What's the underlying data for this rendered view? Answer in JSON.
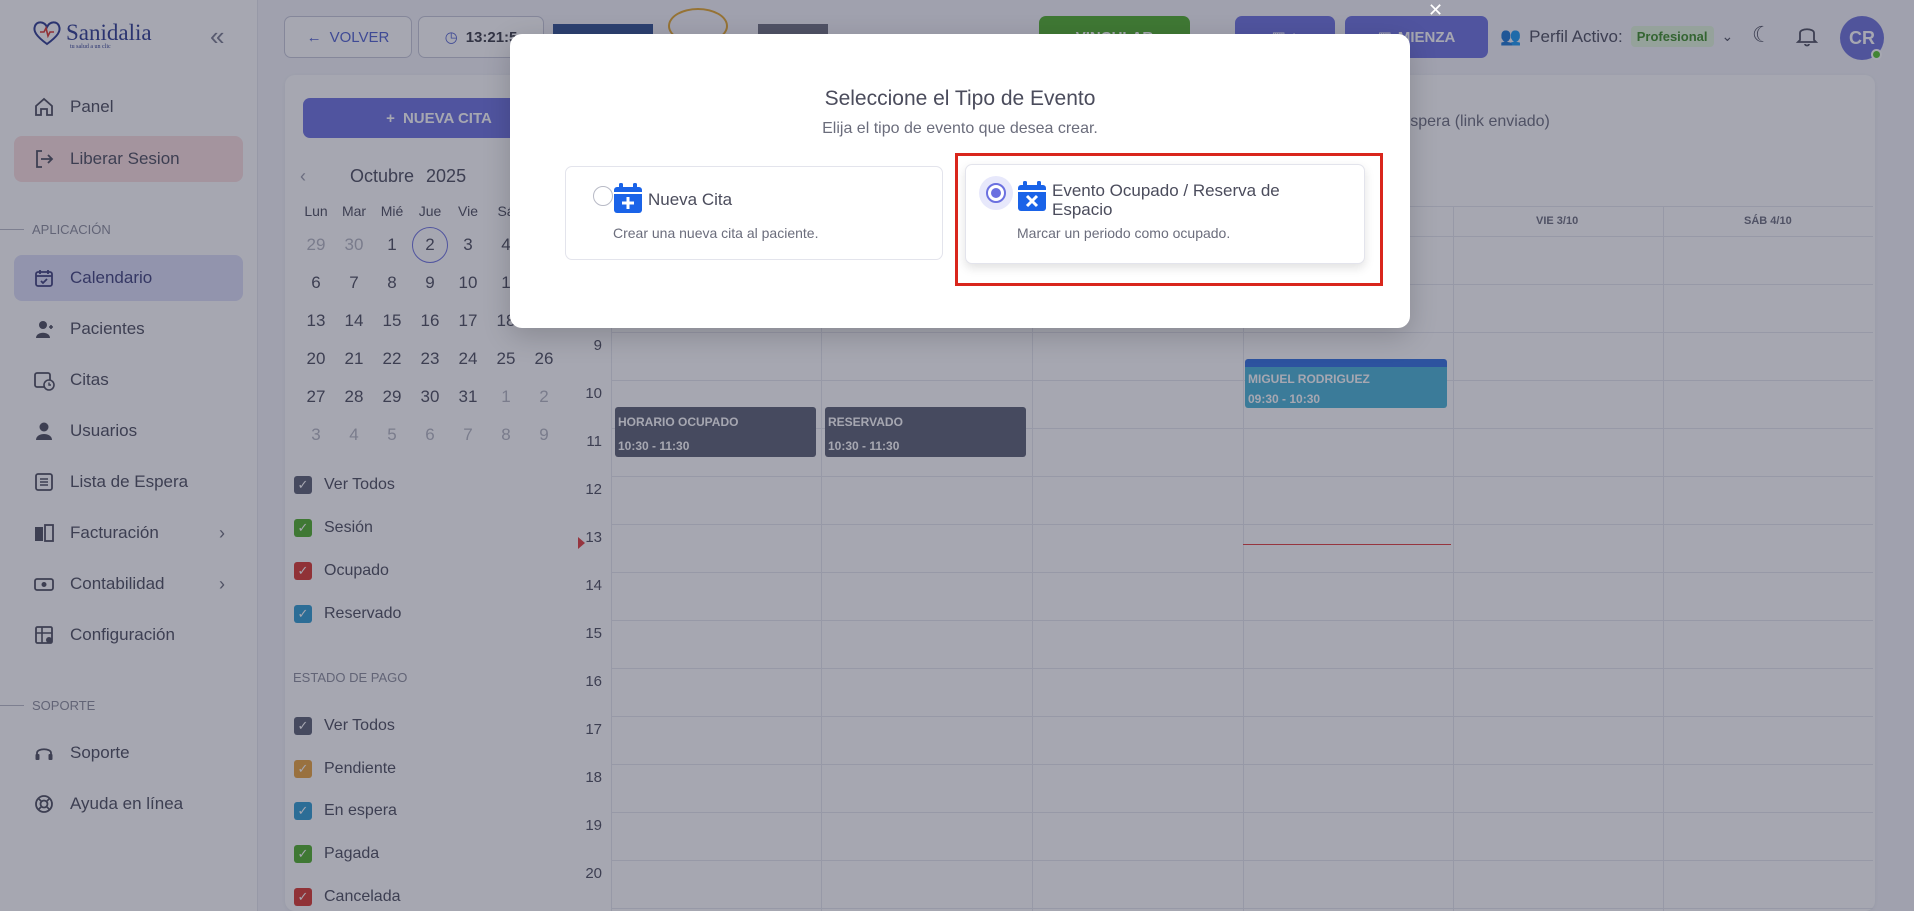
{
  "sidebar": {
    "logo": "Sanidalia",
    "logo_tagline": "tu salud a un clic",
    "items": [
      {
        "label": "Panel"
      },
      {
        "label": "Liberar Sesion"
      },
      {
        "label": "Calendario"
      },
      {
        "label": "Pacientes"
      },
      {
        "label": "Citas"
      },
      {
        "label": "Usuarios"
      },
      {
        "label": "Lista de Espera"
      },
      {
        "label": "Facturación"
      },
      {
        "label": "Contabilidad"
      },
      {
        "label": "Configuración"
      },
      {
        "label": "Soporte"
      },
      {
        "label": "Ayuda en línea"
      }
    ],
    "section_app": "APLICACIÓN",
    "section_support": "SOPORTE"
  },
  "topbar": {
    "back": "VOLVER",
    "clock": "13:21:5",
    "link_label": "VINCULAR",
    "start_label": "MIENZA",
    "profile_label": "Perfil Activo:",
    "profile_value": "Profesional",
    "avatar": "CR"
  },
  "calendar": {
    "new_cita": "NUEVA CITA",
    "month": "Octubre",
    "year": "2025",
    "weekdays": [
      "Lun",
      "Mar",
      "Mié",
      "Jue",
      "Vie",
      "Sá"
    ],
    "weeks": [
      [
        "29",
        "30",
        "1",
        "2",
        "3",
        "4",
        ""
      ],
      [
        "6",
        "7",
        "8",
        "9",
        "10",
        "1",
        ""
      ],
      [
        "13",
        "14",
        "15",
        "16",
        "17",
        "18",
        ""
      ],
      [
        "20",
        "21",
        "22",
        "23",
        "24",
        "25",
        "26"
      ],
      [
        "27",
        "28",
        "29",
        "30",
        "31",
        "1",
        "2"
      ],
      [
        "3",
        "4",
        "5",
        "6",
        "7",
        "8",
        "9"
      ]
    ],
    "filters_type": [
      {
        "label": "Ver Todos",
        "color": "#5a5f73"
      },
      {
        "label": "Sesión",
        "color": "#4fae28"
      },
      {
        "label": "Ocupado",
        "color": "#d9362e"
      },
      {
        "label": "Reservado",
        "color": "#2d9bd0"
      }
    ],
    "payment_title": "ESTADO DE PAGO",
    "filters_payment": [
      {
        "label": "Ver Todos",
        "color": "#5a5f73"
      },
      {
        "label": "Pendiente",
        "color": "#e9a23b"
      },
      {
        "label": "En espera",
        "color": "#2d9bd0"
      },
      {
        "label": "Pagada",
        "color": "#4fae28"
      },
      {
        "label": "Cancelada",
        "color": "#d9362e"
      }
    ],
    "bg_legend": "n espera (link enviado)",
    "day_headers": [
      "VIE 3/10",
      "SÁB 4/10"
    ],
    "hours": [
      "9",
      "10",
      "11",
      "12",
      "13",
      "14",
      "15",
      "16",
      "17",
      "18",
      "19",
      "20"
    ],
    "events": [
      {
        "title": "HORARIO OCUPADO",
        "time": "10:30 - 11:30"
      },
      {
        "title": "RESERVADO",
        "time": "10:30 - 11:30"
      },
      {
        "title": "MIGUEL RODRIGUEZ",
        "time": "09:30 - 10:30"
      }
    ]
  },
  "modal": {
    "title": "Seleccione el Tipo de Evento",
    "subtitle": "Elija el tipo de evento que desea crear.",
    "options": [
      {
        "title": "Nueva Cita",
        "desc": "Crear una nueva cita al paciente.",
        "selected": false
      },
      {
        "title_line1": "Evento Ocupado / Reserva de",
        "title_line2": "Espacio",
        "desc": "Marcar un periodo como ocupado.",
        "selected": true
      }
    ]
  }
}
